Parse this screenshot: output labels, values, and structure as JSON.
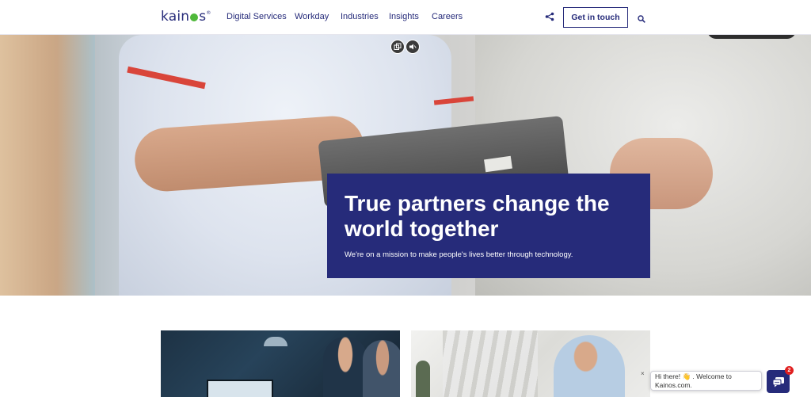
{
  "header": {
    "logo": {
      "text_before": "kain",
      "text_after": "s",
      "mark": "®"
    },
    "nav": [
      {
        "label": "Digital Services"
      },
      {
        "label": "Workday"
      },
      {
        "label": "Industries"
      },
      {
        "label": "Insights"
      },
      {
        "label": "Careers"
      }
    ],
    "share_icon": "share-icon",
    "cta_label": "Get in touch",
    "search_icon": "search-icon"
  },
  "hero": {
    "title": "True partners change the world together",
    "subtitle": "We're on a mission to make people's lives better through technology.",
    "media_buttons": [
      "copy-icon",
      "mute-icon"
    ]
  },
  "chat": {
    "greeting": "Hi there! 👋 . Welcome to Kainos.com.",
    "close": "×",
    "unread_count": "2"
  },
  "colors": {
    "brand": "#262b7a",
    "logo_accent": "#4fb83a",
    "badge": "#e02020"
  }
}
